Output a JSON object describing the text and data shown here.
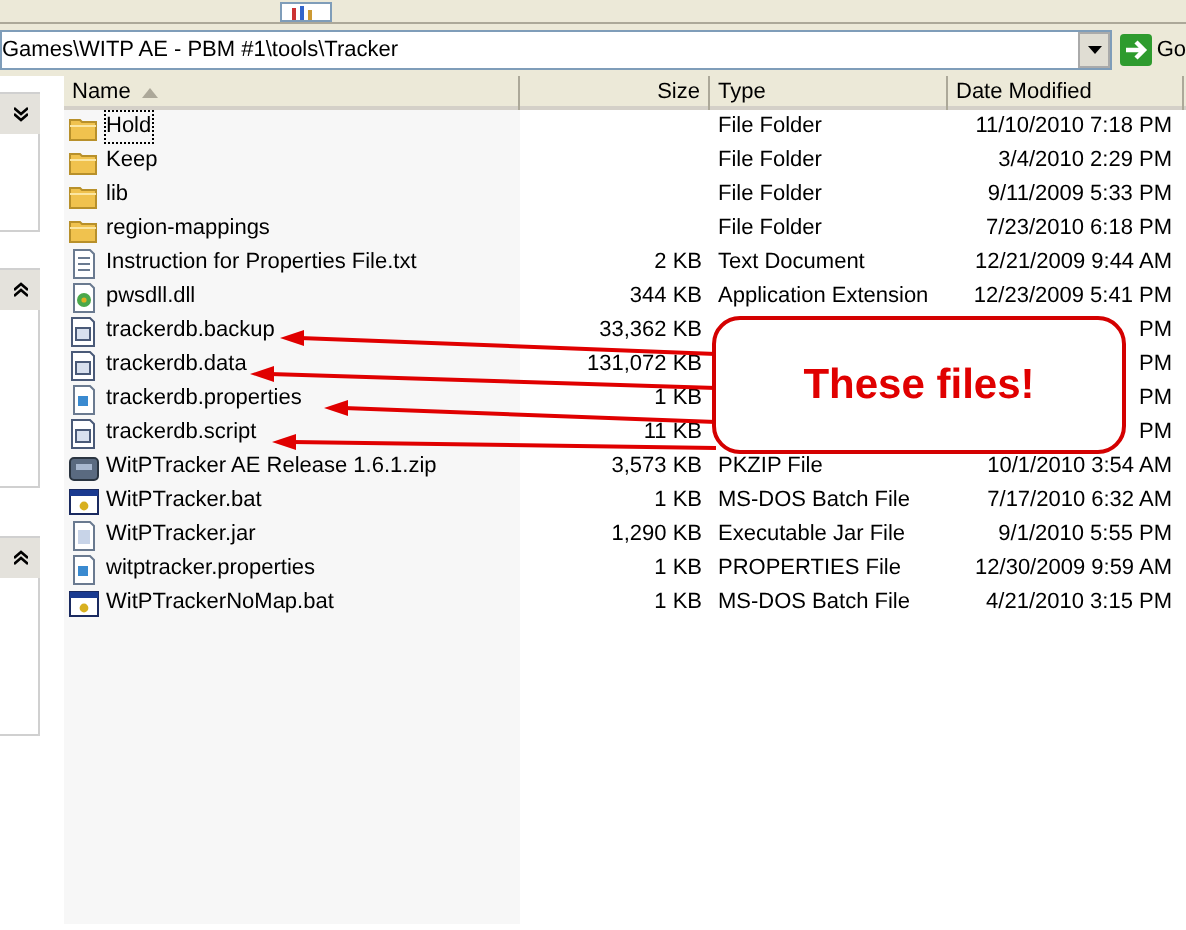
{
  "address_bar": {
    "path": "Games\\WITP AE - PBM #1\\tools\\Tracker",
    "go_label": "Go"
  },
  "columns": [
    {
      "label": "Name",
      "sorted": true
    },
    {
      "label": "Size",
      "sorted": false
    },
    {
      "label": "Type",
      "sorted": false
    },
    {
      "label": "Date Modified",
      "sorted": false
    }
  ],
  "files": [
    {
      "kind": "folder",
      "name": "Hold",
      "type": "File Folder",
      "date": "11/10/2010 7:18 PM",
      "focused": true
    },
    {
      "kind": "folder",
      "name": "Keep",
      "type": "File Folder",
      "date": "3/4/2010 2:29 PM",
      "focused": false
    },
    {
      "kind": "folder",
      "name": "lib",
      "type": "File Folder",
      "date": "9/11/2009 5:33 PM",
      "focused": false
    },
    {
      "kind": "folder",
      "name": "region-mappings",
      "type": "File Folder",
      "date": "7/23/2010 6:18 PM",
      "focused": false
    },
    {
      "kind": "text",
      "name": "Instruction for Properties File.txt",
      "size": "2 KB",
      "type": "Text Document",
      "date": "12/21/2009 9:44 AM",
      "focused": false
    },
    {
      "kind": "dll",
      "name": "pwsdll.dll",
      "size": "344 KB",
      "type": "Application Extension",
      "date": "12/23/2009 5:41 PM",
      "focused": false
    },
    {
      "kind": "script",
      "name": "trackerdb.backup",
      "size": "33,362 KB",
      "date": "PM",
      "focused": false
    },
    {
      "kind": "script",
      "name": "trackerdb.data",
      "size": "131,072 KB",
      "date": "PM",
      "focused": false
    },
    {
      "kind": "properties",
      "name": "trackerdb.properties",
      "size": "1 KB",
      "date": "PM",
      "focused": false
    },
    {
      "kind": "script",
      "name": "trackerdb.script",
      "size": "11 KB",
      "date": "PM",
      "focused": false
    },
    {
      "kind": "zip",
      "name": "WitPTracker AE Release 1.6.1.zip",
      "size": "3,573 KB",
      "type": "PKZIP File",
      "date": "10/1/2010 3:54 AM",
      "focused": false
    },
    {
      "kind": "batch",
      "name": "WitPTracker.bat",
      "size": "1 KB",
      "type": "MS-DOS Batch File",
      "date": "7/17/2010 6:32 AM",
      "focused": false
    },
    {
      "kind": "jar",
      "name": "WitPTracker.jar",
      "size": "1,290 KB",
      "type": "Executable Jar File",
      "date": "9/1/2010 5:55 PM",
      "focused": false
    },
    {
      "kind": "properties",
      "name": "witptracker.properties",
      "size": "1 KB",
      "type": "PROPERTIES File",
      "date": "12/30/2009 9:59 AM",
      "focused": false
    },
    {
      "kind": "batch",
      "name": "WitPTrackerNoMap.bat",
      "size": "1 KB",
      "type": "MS-DOS Batch File",
      "date": "4/21/2010 3:15 PM",
      "focused": false
    }
  ],
  "callout": {
    "text": "These files!"
  }
}
